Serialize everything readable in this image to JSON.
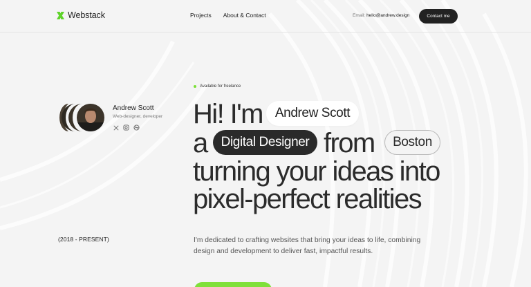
{
  "header": {
    "brand": "Webstack",
    "nav": [
      "Projects",
      "About & Contact"
    ],
    "email_label": "Email:",
    "email_value": "hello@andrew.design",
    "contact_button": "Contact me"
  },
  "profile": {
    "name": "Andrew Scott",
    "role": "Web-designer, developer",
    "socials": [
      "x-icon",
      "instagram-icon",
      "dribbble-icon"
    ]
  },
  "period": "(2018 - PRESENT)",
  "status": {
    "text": "Available for freelance",
    "dot_color": "#7ae036"
  },
  "hero": {
    "line1_prefix": "Hi! I'm",
    "name_pill": "Andrew Scott",
    "line2_prefix": "a",
    "role_pill": "Digital Designer",
    "line2_mid": "from",
    "city_pill": "Boston",
    "line3": "turning your ideas into",
    "line4": "pixel-perfect realities"
  },
  "description": "I'm dedicated to crafting websites that bring your ideas to life, combining design and development to deliver fast, impactful results.",
  "colors": {
    "accent": "#7fe03a",
    "dark": "#2a2a2a",
    "background": "#f4f4f4"
  }
}
